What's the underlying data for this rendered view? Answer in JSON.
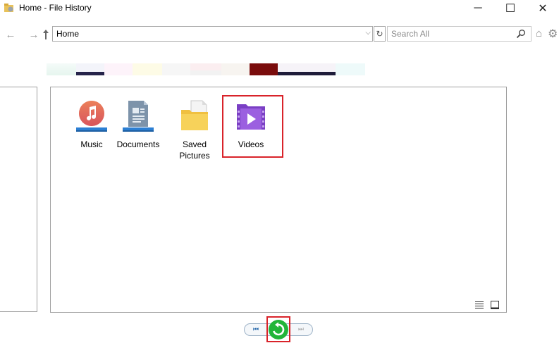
{
  "window": {
    "title": "Home - File History",
    "minimize_glyph": "─",
    "maximize_glyph": "☐",
    "close_glyph": "✕"
  },
  "navigation": {
    "back_glyph": "←",
    "forward_glyph": "→",
    "up_glyph": "🡡",
    "address_value": "Home",
    "dropdown_glyph": "⌵",
    "refresh_glyph": "↻",
    "search_placeholder": "Search All",
    "home_glyph": "⌂",
    "settings_glyph": "⚙"
  },
  "folders": [
    {
      "label": "Music",
      "icon": "music-folder-icon"
    },
    {
      "label": "Documents",
      "icon": "documents-folder-icon"
    },
    {
      "label": "Saved\nPictures",
      "icon": "saved-pictures-folder-icon"
    },
    {
      "label": "Videos",
      "icon": "videos-folder-icon",
      "highlighted": true
    }
  ],
  "playback": {
    "previous_glyph": "⏮",
    "next_glyph": "⏭",
    "restore_icon": "restore-icon"
  },
  "colors": {
    "highlight": "#d9232a",
    "restore_green": "#22b539",
    "timeline_marker": "#7a0c0c"
  }
}
